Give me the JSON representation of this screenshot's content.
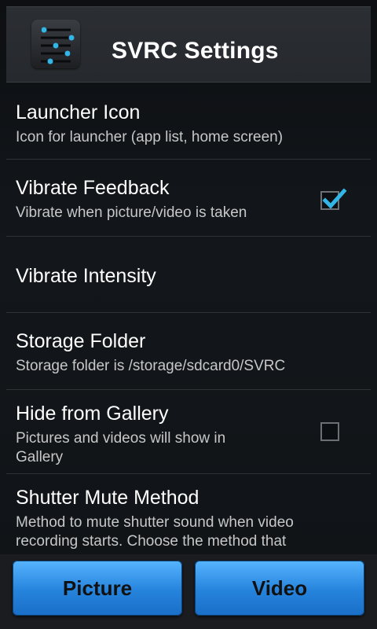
{
  "app_bar": {
    "title": "SVRC Settings",
    "icon": "sliders-icon",
    "accent": "#33b5e5"
  },
  "settings": [
    {
      "title": "Launcher Icon",
      "summary": "Icon for launcher (app list, home screen)"
    },
    {
      "title": "Vibrate Feedback",
      "summary": "Vibrate when picture/video is taken",
      "checked": true
    },
    {
      "title": "Vibrate Intensity"
    },
    {
      "title": "Storage Folder",
      "summary": "Storage folder is /storage/sdcard0/SVRC"
    },
    {
      "title": "Hide from Gallery",
      "summary_line1": "Pictures and videos will show in",
      "summary_line2": "Gallery",
      "checked": false
    },
    {
      "title": "Shutter Mute Method",
      "summary_line1": "Method to mute shutter sound when video",
      "summary_line2": "recording starts. Choose the method that"
    }
  ],
  "buttons": {
    "picture": "Picture",
    "video": "Video",
    "color": "#2f8fe8"
  }
}
